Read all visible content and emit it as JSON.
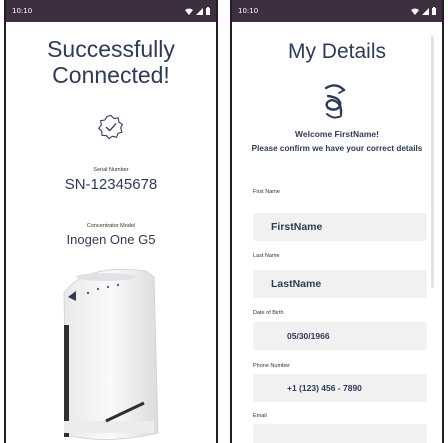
{
  "status_bar": {
    "time": "10:10"
  },
  "left_screen": {
    "title_line1": "Successfully",
    "title_line2": "Connected!",
    "serial": {
      "label": "Serial Number",
      "value": "SN-12345678"
    },
    "model": {
      "label": "Concentrator Model",
      "value": "Inogen One G5"
    },
    "icons": {
      "badge": "check-badge-icon"
    }
  },
  "right_screen": {
    "title": "My Details",
    "welcome": "Welcome FirstName!",
    "confirm": "Please confirm we have your correct details",
    "fields": [
      {
        "label": "First Name",
        "value": "FirstName"
      },
      {
        "label": "Last Name",
        "value": "LastName"
      },
      {
        "label": "Date of Birth",
        "value": "05/30/1966"
      },
      {
        "label": "Phone Number",
        "value": "+1 (123) 456 - 7890"
      },
      {
        "label": "Email",
        "value": ""
      }
    ],
    "icons": {
      "logo": "brand-logo-icon"
    }
  },
  "colors": {
    "status_bar": "#3d2f40",
    "heading": "#2f3b56",
    "field_bg": "#f1f1f1"
  }
}
